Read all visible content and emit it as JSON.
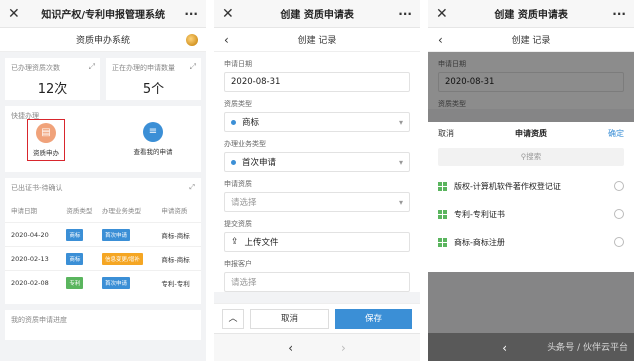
{
  "screen1": {
    "title": "知识产权/专利申报管理系统",
    "subtitle": "资质申办系统",
    "stats": [
      {
        "label": "已办理资质次数",
        "value": "12次"
      },
      {
        "label": "正在办理的申请数量",
        "value": "5个"
      }
    ],
    "quick": {
      "header": "快捷办理",
      "items": [
        "资质申办",
        "查看我的申请"
      ]
    },
    "table": {
      "header": "已出证书-待确认",
      "columns": [
        "申请日期",
        "资质类型",
        "办理业务类型",
        "申请资质"
      ],
      "rows": [
        {
          "date": "2020-04-20",
          "type": "商标",
          "biz": "首次申请",
          "qual": "商标-商标"
        },
        {
          "date": "2020-02-13",
          "type": "商标",
          "biz": "信息变更/增补",
          "qual": "商标-商标"
        },
        {
          "date": "2020-02-08",
          "type": "专利",
          "biz": "首次申请",
          "qual": "专利-专利"
        }
      ]
    },
    "progress_header": "我的资质申请进度"
  },
  "screen2": {
    "title": "创建 资质申请表",
    "subtitle": "创建 记录",
    "fields": [
      {
        "label": "申请日期",
        "value": "2020-08-31"
      },
      {
        "label": "资质类型",
        "value": "商标"
      },
      {
        "label": "办理业务类型",
        "value": "首次申请"
      },
      {
        "label": "申请资质",
        "value": "请选择"
      },
      {
        "label": "提交资质",
        "value": "上传文件"
      },
      {
        "label": "申报客户",
        "value": "请选择"
      }
    ],
    "buttons": {
      "cancel": "取消",
      "save": "保存"
    }
  },
  "screen3": {
    "title": "创建 资质申请表",
    "subtitle": "创建 记录",
    "field_label": "申请日期",
    "field_value": "2020-08-31",
    "field_label2": "资质类型",
    "sheet": {
      "cancel": "取消",
      "title": "申请资质",
      "confirm": "确定",
      "search_placeholder": "搜索",
      "options": [
        "版权-计算机软件著作权登记证",
        "专利-专利证书",
        "商标-商标注册"
      ]
    },
    "watermark": "头条号 / 伙伴云平台"
  },
  "colors": {
    "primary": "#3b8fd6",
    "orange": "#f5a623",
    "green": "#5ab55e",
    "highlight": "#d8262d"
  }
}
